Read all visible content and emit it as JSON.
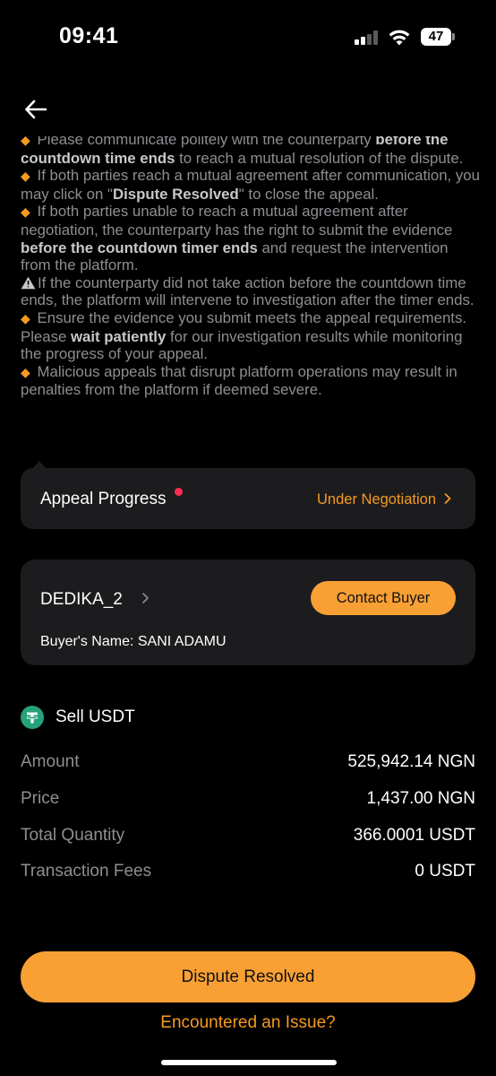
{
  "status_bar": {
    "time": "09:41",
    "battery": "47",
    "icons": [
      "cellular-signal-icon",
      "wifi-icon",
      "battery-icon"
    ]
  },
  "nav": {
    "back_icon": "arrow-left-icon"
  },
  "notes": [
    {
      "icon": "diamond-icon",
      "parts": [
        [
          "Please communicate politely with the counterparty ",
          false
        ],
        [
          "before the countdown time ends",
          true
        ],
        [
          " to reach a mutual resolution of the dispute.",
          false
        ]
      ]
    },
    {
      "icon": "diamond-icon",
      "parts": [
        [
          "If both parties reach a mutual agreement after communication, you may click on \"",
          false
        ],
        [
          "Dispute Resolved",
          true
        ],
        [
          "\" to close the appeal.",
          false
        ]
      ]
    },
    {
      "icon": "diamond-icon",
      "parts": [
        [
          "If both parties unable to reach a mutual agreement after negotiation, the counterparty has the right to submit the evidence ",
          false
        ],
        [
          "before the countdown timer ends",
          true
        ],
        [
          " and request the intervention from the platform.",
          false
        ]
      ]
    },
    {
      "icon": "warning-icon",
      "parts": [
        [
          "If the counterparty did not take action before the countdown time ends, the platform will intervene to investigation after the timer ends.",
          false
        ]
      ]
    },
    {
      "icon": "diamond-icon",
      "parts": [
        [
          "Ensure the evidence you submit meets the appeal requirements. Please ",
          false
        ],
        [
          "wait patiently",
          true
        ],
        [
          " for our investigation results while monitoring the progress of your appeal.",
          false
        ]
      ]
    },
    {
      "icon": "diamond-icon",
      "parts": [
        [
          "Malicious appeals that disrupt platform operations may result in penalties from the platform if deemed severe.",
          false
        ]
      ]
    }
  ],
  "appeal": {
    "title": "Appeal Progress",
    "status": "Under Negotiation"
  },
  "buyer": {
    "nickname": "DEDIKA_2",
    "contact_label": "Contact Buyer",
    "name_line": "Buyer's Name: SANI ADAMU"
  },
  "order": {
    "sell_label": "Sell USDT",
    "rows": [
      {
        "label": "Amount",
        "value": "525,942.14 NGN"
      },
      {
        "label": "Price",
        "value": "1,437.00 NGN"
      },
      {
        "label": "Total Quantity",
        "value": "366.0001 USDT"
      },
      {
        "label": "Transaction Fees",
        "value": "0 USDT"
      }
    ]
  },
  "actions": {
    "primary": "Dispute Resolved",
    "secondary": "Encountered an Issue?"
  },
  "colors": {
    "accent": "#f9a035",
    "accent_text": "#f59a23",
    "card": "#1c1c1e",
    "muted": "#8e8e93",
    "tether": "#26a17b",
    "alert_dot": "#ff2d55"
  }
}
